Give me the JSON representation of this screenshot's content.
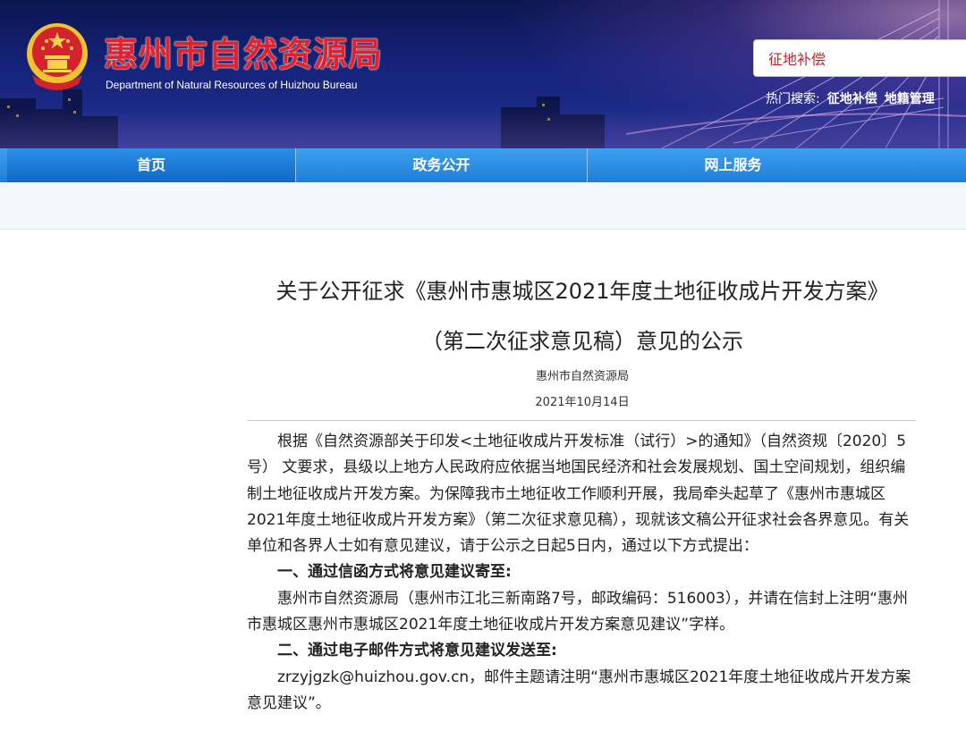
{
  "header": {
    "site_title": "惠州市自然资源局",
    "site_subtitle": "Department of Natural Resources of Huizhou Bureau",
    "search": {
      "value": "征地补偿"
    },
    "hot_search_label": "热门搜索:",
    "hot_keywords": [
      "征地补偿",
      "地籍管理"
    ]
  },
  "nav": {
    "items": [
      {
        "label": "首页",
        "active": true
      },
      {
        "label": "政务公开",
        "active": false
      },
      {
        "label": "网上服务",
        "active": false
      }
    ]
  },
  "article": {
    "title_line1": "关于公开征求《惠州市惠城区2021年度土地征收成片开发方案》",
    "title_line2": "（第二次征求意见稿）意见的公示",
    "author": "惠州市自然资源局",
    "date": "2021年10月14日",
    "paragraphs": [
      "根据《自然资源部关于印发<土地征收成片开发标准（试行）>的通知》（自然资规〔2020〕5号） 文要求，县级以上地方人民政府应依据当地国民经济和社会发展规划、国土空间规划，组织编制土地征收成片开发方案。为保障我市土地征收工作顺利开展，我局牵头起草了《惠州市惠城区2021年度土地征收成片开发方案》（第二次征求意见稿），现就该文稿公开征求社会各界意见。有关单位和各界人士如有意见建议，请于公示之日起5日内，通过以下方式提出：",
      "一、通过信函方式将意见建议寄至:",
      "惠州市自然资源局（惠州市江北三新南路7号，邮政编码：516003），并请在信封上注明“惠州市惠城区惠州市惠城区2021年度土地征收成片开发方案意见建议”字样。",
      "二、通过电子邮件方式将意见建议发送至:",
      "zrzyjgzk@huizhou.gov.cn，邮件主题请注明“惠州市惠城区2021年度土地征收成片开发方案意见建议”。"
    ]
  },
  "colors": {
    "title_red": "#e2212b",
    "nav_blue": "#1f7ed6",
    "header_navy": "#16237a"
  }
}
